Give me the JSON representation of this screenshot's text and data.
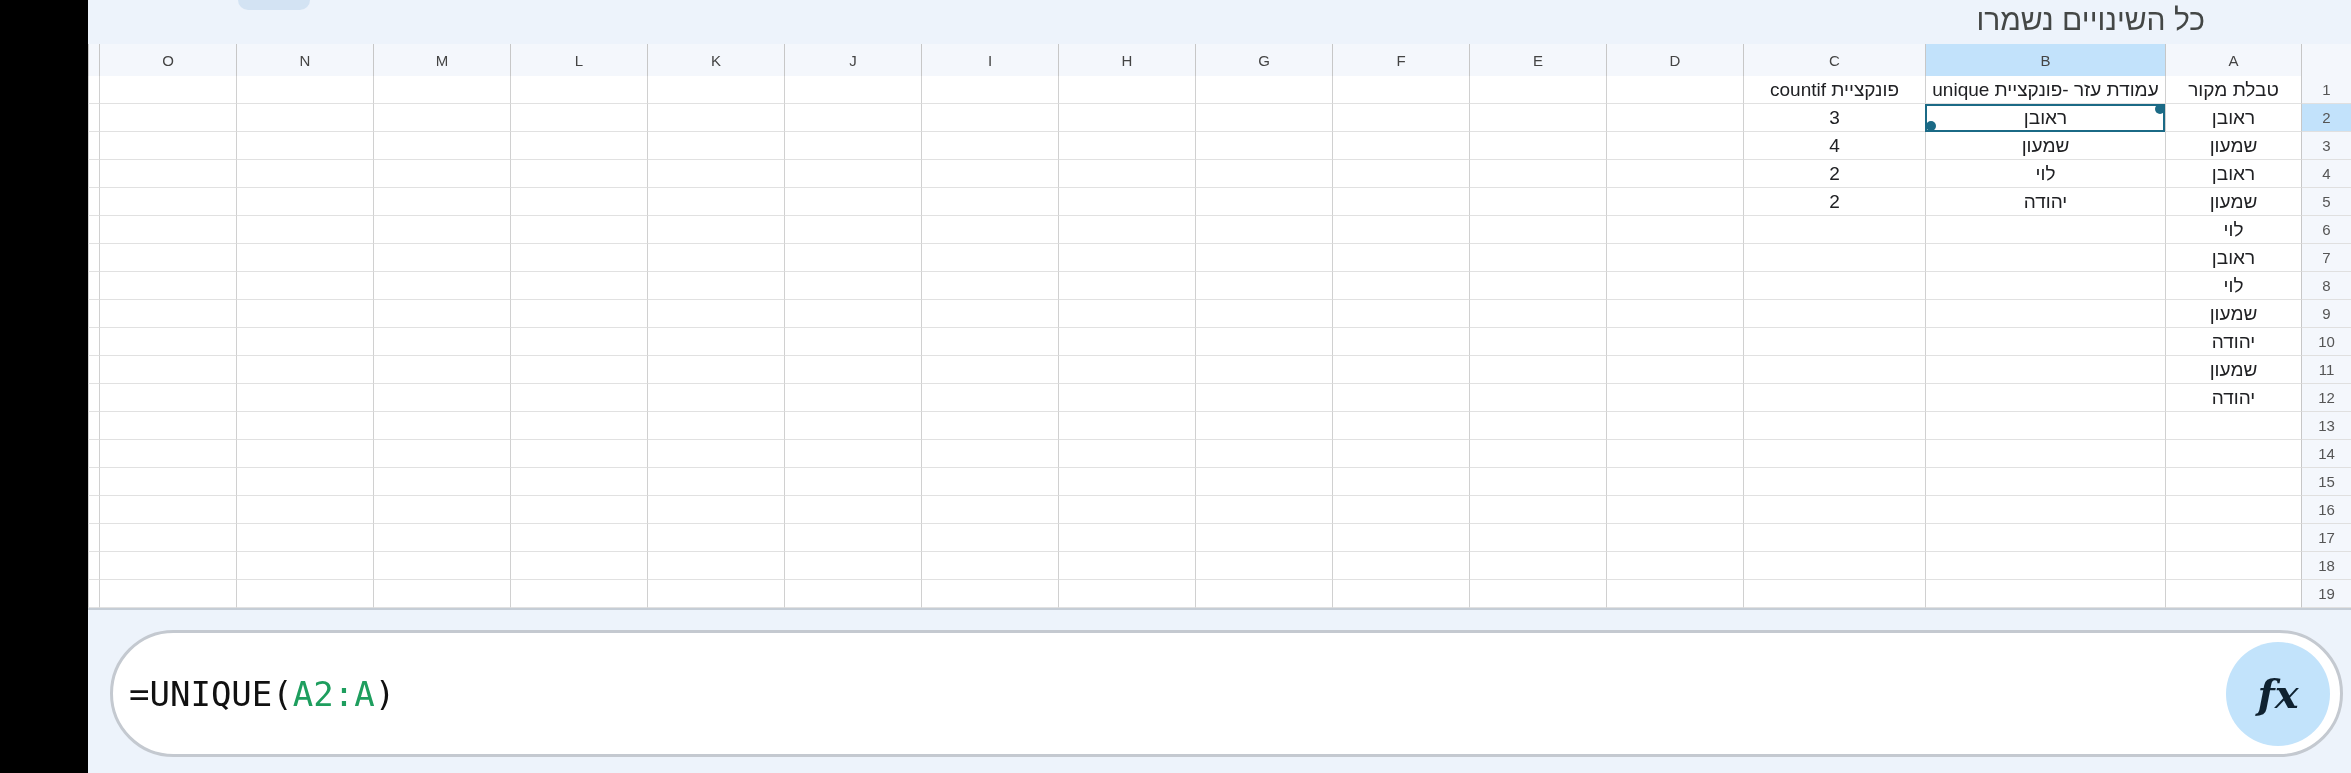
{
  "header": {
    "status": "כל השינויים נשמרו"
  },
  "sheet": {
    "columns": [
      {
        "label": "A",
        "selected": false
      },
      {
        "label": "B",
        "selected": true
      },
      {
        "label": "C",
        "selected": false
      },
      {
        "label": "D",
        "selected": false
      },
      {
        "label": "E",
        "selected": false
      },
      {
        "label": "F",
        "selected": false
      },
      {
        "label": "G",
        "selected": false
      },
      {
        "label": "H",
        "selected": false
      },
      {
        "label": "I",
        "selected": false
      },
      {
        "label": "J",
        "selected": false
      },
      {
        "label": "K",
        "selected": false
      },
      {
        "label": "L",
        "selected": false
      },
      {
        "label": "M",
        "selected": false
      },
      {
        "label": "N",
        "selected": false
      },
      {
        "label": "O",
        "selected": false
      }
    ],
    "rows": [
      {
        "number": "1",
        "selected": false,
        "cells": [
          {
            "text": "טבלת מקור",
            "selected": false
          },
          {
            "text": "עמודת עזר -פונקציית unique",
            "selected": false
          },
          {
            "text": "פונקציית countif",
            "selected": false
          }
        ]
      },
      {
        "number": "2",
        "selected": true,
        "cells": [
          {
            "text": "ראובן",
            "selected": false
          },
          {
            "text": "ראובן",
            "selected": true
          },
          {
            "text": "3",
            "selected": false
          }
        ]
      },
      {
        "number": "3",
        "selected": false,
        "cells": [
          {
            "text": "שמעון",
            "selected": false
          },
          {
            "text": "שמעון",
            "selected": false
          },
          {
            "text": "4",
            "selected": false
          }
        ]
      },
      {
        "number": "4",
        "selected": false,
        "cells": [
          {
            "text": "ראובן",
            "selected": false
          },
          {
            "text": "לוי",
            "selected": false
          },
          {
            "text": "2",
            "selected": false
          }
        ]
      },
      {
        "number": "5",
        "selected": false,
        "cells": [
          {
            "text": "שמעון",
            "selected": false
          },
          {
            "text": "יהודה",
            "selected": false
          },
          {
            "text": "2",
            "selected": false
          }
        ]
      },
      {
        "number": "6",
        "selected": false,
        "cells": [
          {
            "text": "לוי",
            "selected": false
          }
        ]
      },
      {
        "number": "7",
        "selected": false,
        "cells": [
          {
            "text": "ראובן",
            "selected": false
          }
        ]
      },
      {
        "number": "8",
        "selected": false,
        "cells": [
          {
            "text": "לוי",
            "selected": false
          }
        ]
      },
      {
        "number": "9",
        "selected": false,
        "cells": [
          {
            "text": "שמעון",
            "selected": false
          }
        ]
      },
      {
        "number": "10",
        "selected": false,
        "cells": [
          {
            "text": "יהודה",
            "selected": false
          }
        ]
      },
      {
        "number": "11",
        "selected": false,
        "cells": [
          {
            "text": "שמעון",
            "selected": false
          }
        ]
      },
      {
        "number": "12",
        "selected": false,
        "cells": [
          {
            "text": "יהודה",
            "selected": false
          }
        ]
      },
      {
        "number": "13",
        "selected": false
      },
      {
        "number": "14",
        "selected": false
      },
      {
        "number": "15",
        "selected": false
      },
      {
        "number": "16",
        "selected": false
      },
      {
        "number": "17",
        "selected": false
      },
      {
        "number": "18",
        "selected": false
      },
      {
        "number": "19",
        "selected": false
      }
    ]
  },
  "formula_bar": {
    "formula": {
      "head": "=UNIQUE(",
      "range": "A2:A",
      "tail": ")"
    },
    "fx_button": {
      "label": "fx"
    }
  }
}
